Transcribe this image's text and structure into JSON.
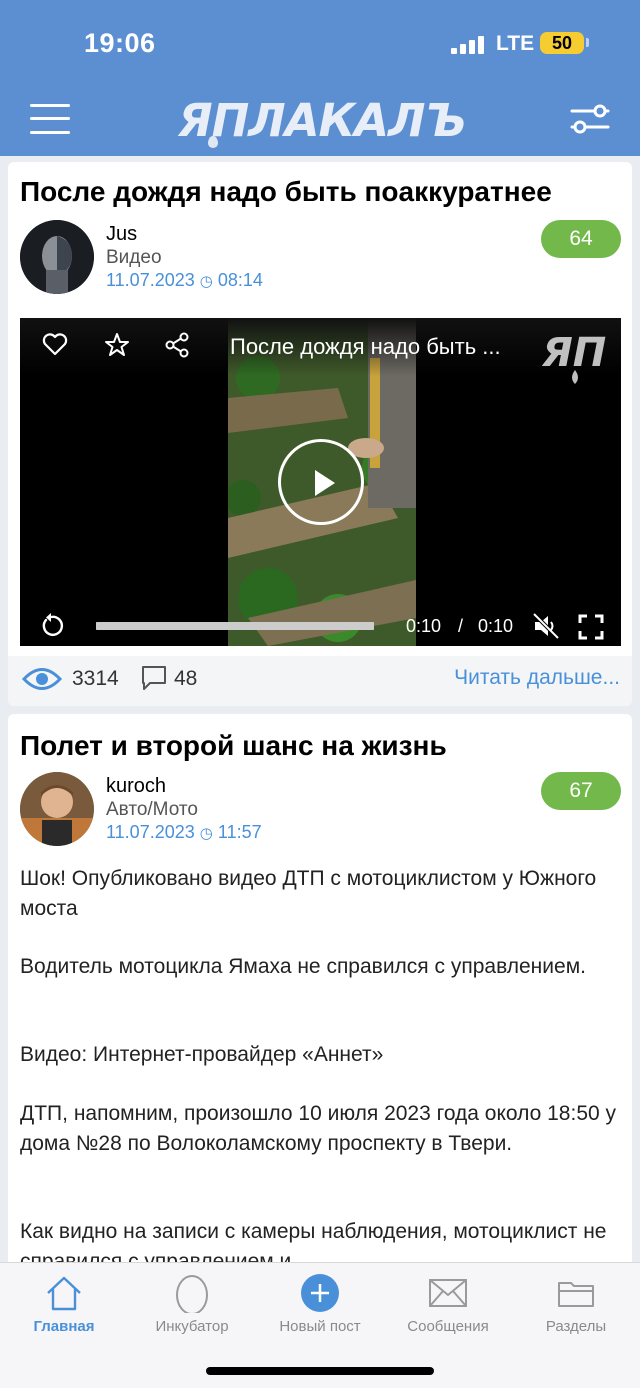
{
  "status_bar": {
    "time": "19:06",
    "network": "LTE",
    "battery": "50"
  },
  "header": {
    "logo": "ЯПЛАКАЛЪ"
  },
  "posts": [
    {
      "title": "После дождя надо быть поаккуратнее",
      "author": "Jus",
      "category": "Видео",
      "date": "11.07.2023",
      "time": "08:14",
      "rating": "64",
      "video": {
        "title": "После дождя надо быть ...",
        "current_time": "0:10",
        "separator": "/",
        "total_time": "0:10",
        "progress": 1.0
      },
      "views": "3314",
      "comments": "48",
      "read_more": "Читать дальше..."
    },
    {
      "title": "Полет и второй шанс на жизнь",
      "author": "kuroch",
      "category": "Авто/Мото",
      "date": "11.07.2023",
      "time": "11:57",
      "rating": "67",
      "paragraphs": [
        "Шок! Опубликовано видео ДТП с мотоциклистом у Южного моста",
        "Водитель мотоцикла Ямаха не справился с управлением.",
        "Видео: Интернет-провайдер «Аннет»",
        "ДТП, напомним, произошло 10 июля 2023 года около 18:50 у дома №28 по Волоколамскому проспекту в Твери.",
        "Как видно на записи с камеры наблюдения, мотоциклист не справился с управлением и"
      ]
    }
  ],
  "bottom_nav": [
    {
      "label": "Главная",
      "icon": "home-icon",
      "active": true
    },
    {
      "label": "Инкубатор",
      "icon": "egg-icon",
      "active": false
    },
    {
      "label": "Новый пост",
      "icon": "plus-icon",
      "active": false
    },
    {
      "label": "Сообщения",
      "icon": "envelope-icon",
      "active": false
    },
    {
      "label": "Разделы",
      "icon": "folder-icon",
      "active": false
    }
  ],
  "colors": {
    "header": "#5b8fd2",
    "accent": "#4a90d9",
    "rating": "#72b84a"
  }
}
